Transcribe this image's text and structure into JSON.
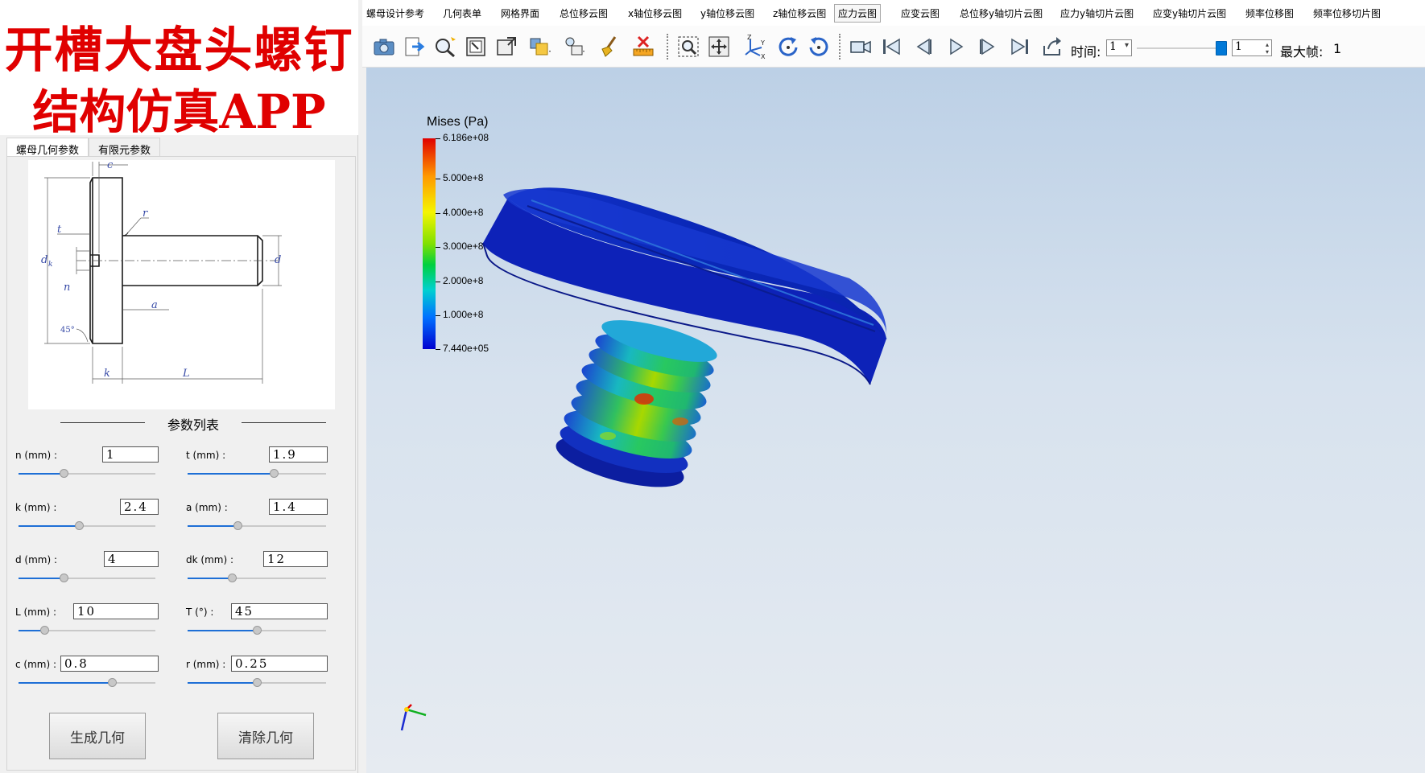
{
  "banner": {
    "line1": "开槽大盘头螺钉",
    "line2": "结构仿真APP"
  },
  "left_tabs": [
    {
      "label": "螺母几何参数",
      "active": true
    },
    {
      "label": "有限元参数",
      "active": false
    }
  ],
  "drawing": {
    "labels": {
      "c": "c",
      "r": "r",
      "t": "t",
      "dk": "d",
      "dk_sub": "k",
      "d": "d",
      "n": "n",
      "a": "a",
      "angle": "45°",
      "k": "k",
      "L": "L"
    }
  },
  "params_title": "参数列表",
  "params": [
    {
      "label": "n (mm) :",
      "value": "1",
      "slider": 0.33
    },
    {
      "label": "t (mm) :",
      "value": "1.9",
      "slider": 0.62
    },
    {
      "label": "k (mm) :",
      "value": "2.4",
      "slider": 0.44
    },
    {
      "label": "a (mm) :",
      "value": "1.4",
      "slider": 0.36
    },
    {
      "label": "d (mm) :",
      "value": "4",
      "slider": 0.33
    },
    {
      "label": "dk (mm) :",
      "value": "12",
      "slider": 0.32
    },
    {
      "label": "L (mm) :",
      "value": "10",
      "slider": 0.19
    },
    {
      "label": "T (°) :",
      "value": "45",
      "slider": 0.5
    },
    {
      "label": "c (mm) :",
      "value": "0.8",
      "slider": 0.68
    },
    {
      "label": "r (mm) :",
      "value": "0.25",
      "slider": 0.5
    }
  ],
  "buttons": {
    "generate": "生成几何",
    "clear": "清除几何"
  },
  "menus": [
    {
      "label": "螺母设计参考",
      "active": false
    },
    {
      "label": "几何表单",
      "active": false
    },
    {
      "label": "网格界面",
      "active": false
    },
    {
      "label": "总位移云图",
      "active": false
    },
    {
      "label": "x轴位移云图",
      "active": false
    },
    {
      "label": "y轴位移云图",
      "active": false
    },
    {
      "label": "z轴位移云图",
      "active": false
    },
    {
      "label": "应力云图",
      "active": true
    },
    {
      "label": "应变云图",
      "active": false
    },
    {
      "label": "总位移y轴切片云图",
      "active": false
    },
    {
      "label": "应力y轴切片云图",
      "active": false
    },
    {
      "label": "应变y轴切片云图",
      "active": false
    },
    {
      "label": "频率位移图",
      "active": false
    },
    {
      "label": "频率位移切片图",
      "active": false
    }
  ],
  "toolbar": {
    "time_label": "时间:",
    "time_value": "1",
    "frame_value": "1",
    "max_frame_label": "最大帧:",
    "max_frame_value": "1",
    "frame_slider": 1.0,
    "axes_letters": {
      "z": "Z",
      "y": "Y",
      "x": "X"
    }
  },
  "colors": {
    "accent": "#0078d7",
    "banner_text": "#e00000"
  },
  "legend": {
    "title": "Mises (Pa)",
    "ticks": [
      "6.186e+08",
      "5.000e+8",
      "4.000e+8",
      "3.000e+8",
      "2.000e+8",
      "1.000e+8",
      "7.440e+05"
    ]
  },
  "chart_data": {
    "type": "heatmap",
    "title": "Mises (Pa)",
    "color_scale": {
      "min": 744000,
      "max": 618600000,
      "ticks": [
        618600000,
        500000000,
        400000000,
        300000000,
        200000000,
        100000000,
        744000
      ],
      "tick_labels": [
        "6.186e+08",
        "5.000e+8",
        "4.000e+8",
        "3.000e+8",
        "2.000e+8",
        "1.000e+8",
        "7.440e+05"
      ],
      "colors": [
        "#e00000",
        "#ff9900",
        "#f5f500",
        "#80e000",
        "#00d040",
        "#00d0d0",
        "#0070ff",
        "#0000d0"
      ]
    }
  }
}
